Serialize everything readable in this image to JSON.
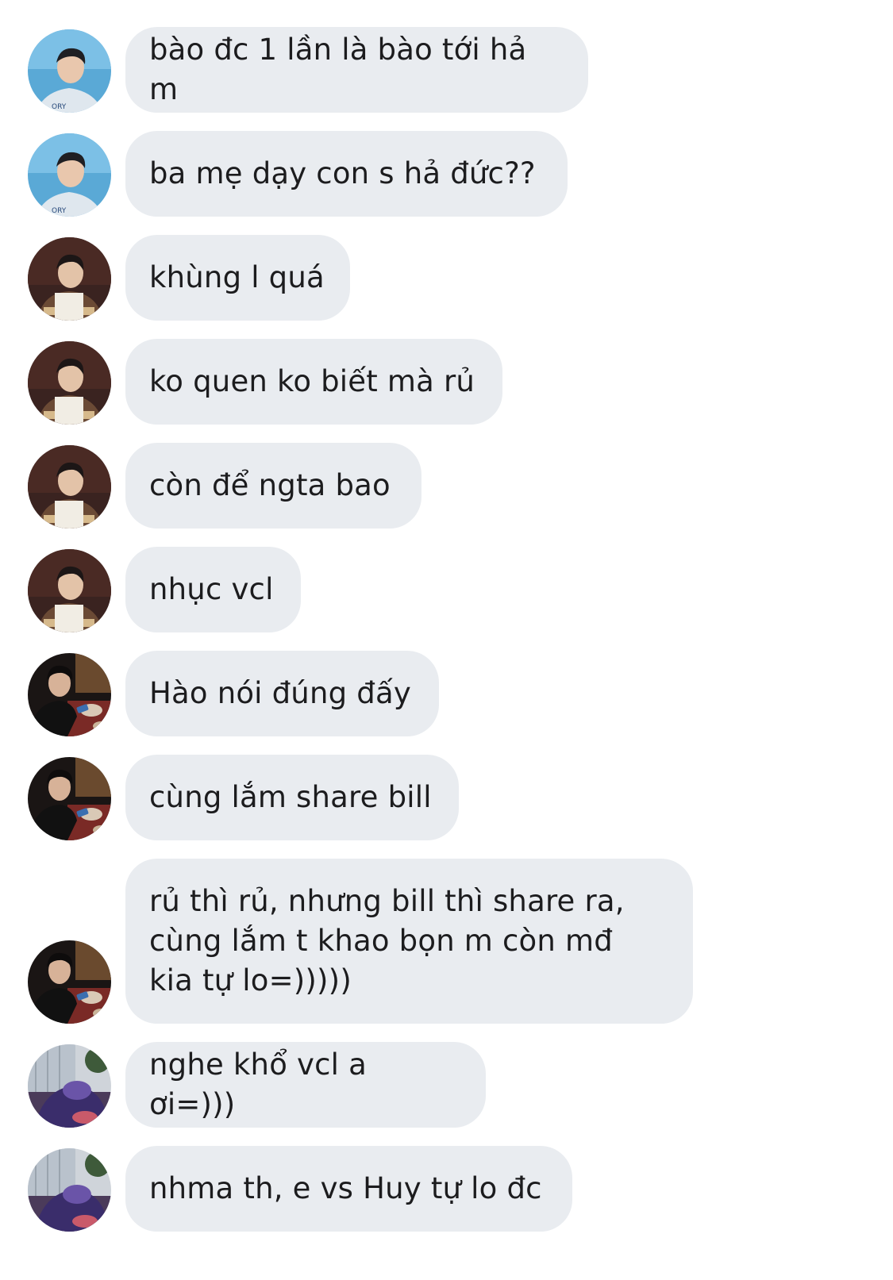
{
  "messages": [
    {
      "text": "bào đc 1 lần là bào tới hả m",
      "avatar": "avatar-blue-sky"
    },
    {
      "text": "ba mẹ dạy con s hả đức??",
      "avatar": "avatar-blue-sky"
    },
    {
      "text": "khùng l quá",
      "avatar": "avatar-brown-portrait"
    },
    {
      "text": "ko quen ko biết mà rủ",
      "avatar": "avatar-brown-portrait"
    },
    {
      "text": "còn để ngta bao",
      "avatar": "avatar-brown-portrait"
    },
    {
      "text": "nhục vcl",
      "avatar": "avatar-brown-portrait"
    },
    {
      "text": "Hào nói đúng đấy",
      "avatar": "avatar-dark-restaurant"
    },
    {
      "text": "cùng lắm share bill",
      "avatar": "avatar-dark-restaurant"
    },
    {
      "text": "rủ thì rủ, nhưng bill thì share ra,\ncùng lắm t khao bọn m còn mđ\nkia tự lo=)))))",
      "avatar": "avatar-dark-restaurant"
    },
    {
      "text": "nghe khổ vcl a ơi=)))",
      "avatar": "avatar-purple-room"
    },
    {
      "text": "nhma th, e vs Huy tự lo đc",
      "avatar": "avatar-purple-room"
    }
  ],
  "colors": {
    "bubble": "#e9ecf0",
    "text": "#1c1c1e",
    "background": "#ffffff"
  }
}
